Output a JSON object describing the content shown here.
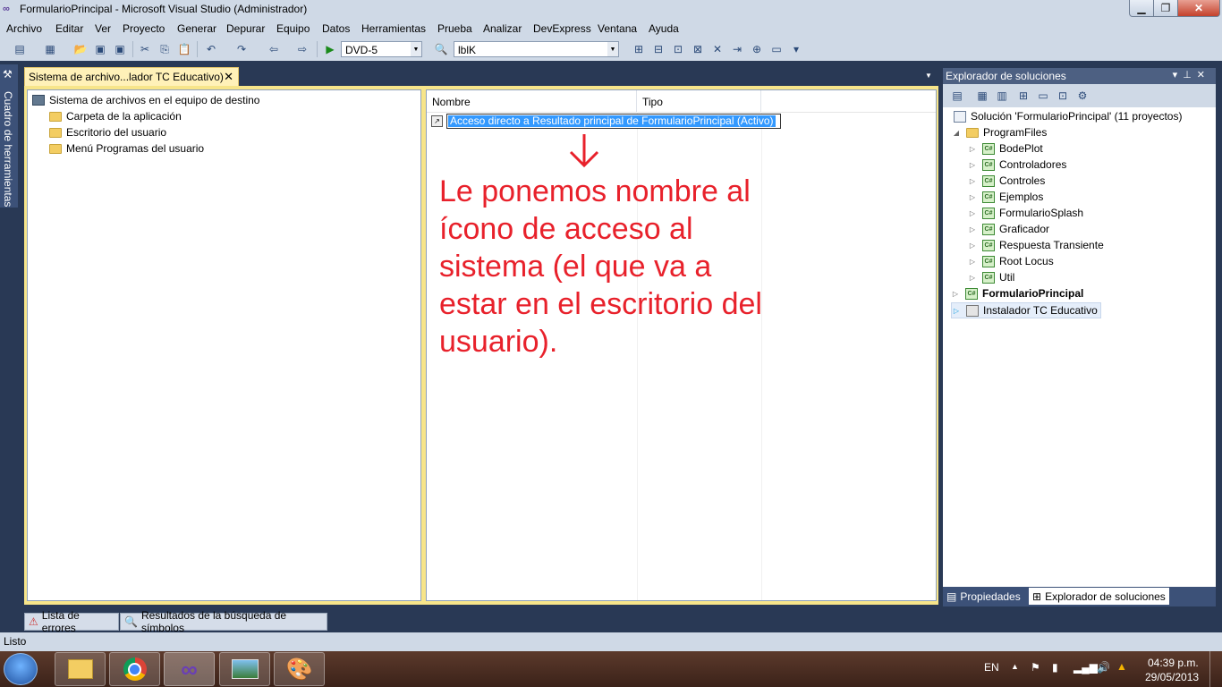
{
  "window": {
    "title": "FormularioPrincipal - Microsoft Visual Studio (Administrador)"
  },
  "menu": [
    "Archivo",
    "Editar",
    "Ver",
    "Proyecto",
    "Generar",
    "Depurar",
    "Equipo",
    "Datos",
    "Herramientas",
    "Prueba",
    "Analizar",
    "DevExpress",
    "Ventana",
    "Ayuda"
  ],
  "toolbar": {
    "config_value": "DVD-5",
    "target_value": "lblK"
  },
  "toolbox": {
    "label": "Cuadro de herramientas"
  },
  "document_tab": {
    "label": "Sistema de archivo...lador TC Educativo)",
    "close": "✕"
  },
  "file_system": {
    "root": "Sistema de archivos en el equipo de destino",
    "folders": [
      "Carpeta de la aplicación",
      "Escritorio del usuario",
      "Menú Programas del usuario"
    ]
  },
  "list": {
    "columns": [
      "Nombre",
      "Tipo"
    ],
    "rename_value": "Acceso directo a Resultado principal de FormularioPrincipal (Activo)"
  },
  "annotation": {
    "arrow": "↓",
    "text": "Le ponemos nombre al ícono de acceso al sistema (el que va a estar en el escritorio del usuario)."
  },
  "solution_explorer": {
    "title": "Explorador de soluciones",
    "solution": "Solución 'FormularioPrincipal'  (11 proyectos)",
    "folder": "ProgramFiles",
    "projects": [
      "BodePlot",
      "Controladores",
      "Controles",
      "Ejemplos",
      "FormularioSplash",
      "Graficador",
      "Respuesta Transiente",
      "Root Locus",
      "Util"
    ],
    "startup_project": "FormularioPrincipal",
    "setup_project": "Instalador TC Educativo",
    "tabs": [
      "Propiedades",
      "Explorador de soluciones"
    ]
  },
  "bottom_tabs": [
    "Lista de errores",
    "Resultados de la búsqueda de símbolos"
  ],
  "status": "Listo",
  "taskbar": {
    "lang": "EN",
    "time": "04:39 p.m.",
    "date": "29/05/2013"
  }
}
